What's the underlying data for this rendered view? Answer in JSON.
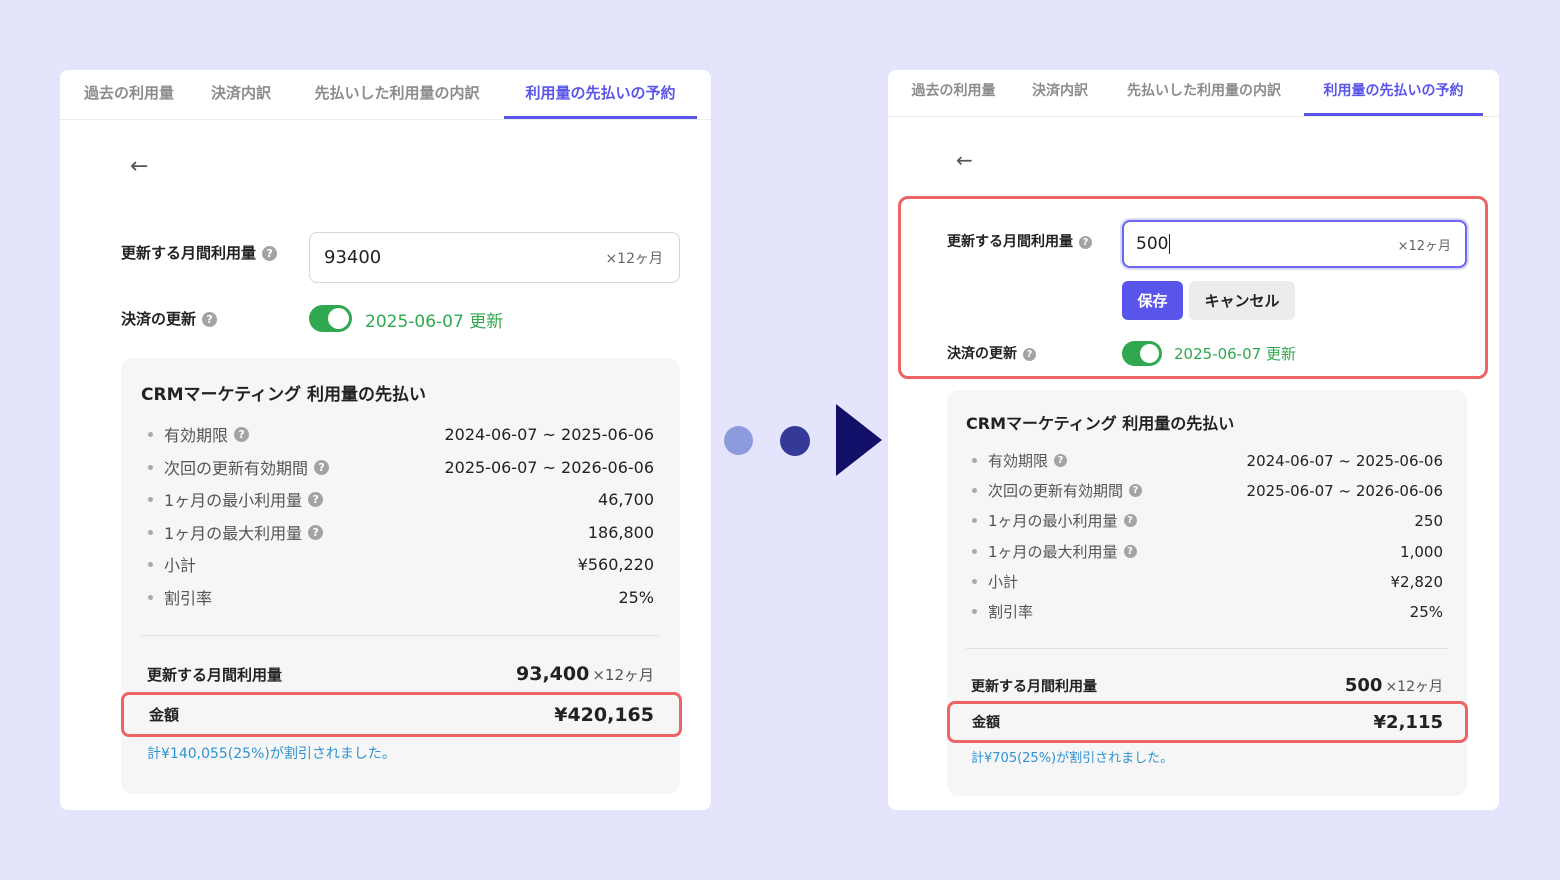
{
  "colors": {
    "background": "#e4e4fd",
    "accent": "#5a55ea",
    "toggle_on": "#2fa84f",
    "highlight": "#ee6464",
    "discount_text": "#2f93d1",
    "arrow": "#13106a"
  },
  "before": {
    "tabs": [
      {
        "label": "過去の利用量",
        "active": false
      },
      {
        "label": "決済内訳",
        "active": false
      },
      {
        "label": "先払いした利用量の内訳",
        "active": false
      },
      {
        "label": "利用量の先払いの予約",
        "active": true
      }
    ],
    "back_icon": "←",
    "form": {
      "monthly_usage_label": "更新する月間利用量",
      "monthly_usage_value": "93400",
      "monthly_usage_suffix": "×12ヶ月",
      "renewal_label": "決済の更新",
      "renewal_toggle_on": true,
      "renewal_date": "2025-06-07 更新"
    },
    "summary": {
      "title": "CRMマーケティング 利用量の先払い",
      "rows": [
        {
          "label": "有効期限",
          "help": true,
          "value": "2024-06-07 ~ 2025-06-06"
        },
        {
          "label": "次回の更新有効期間",
          "help": true,
          "value": "2025-06-07 ~ 2026-06-06"
        },
        {
          "label": "1ヶ月の最小利用量",
          "help": true,
          "value": "46,700"
        },
        {
          "label": "1ヶ月の最大利用量",
          "help": true,
          "value": "186,800"
        },
        {
          "label": "小計",
          "help": false,
          "value": "¥560,220"
        },
        {
          "label": "割引率",
          "help": false,
          "value": "25%"
        }
      ],
      "monthly_label": "更新する月間利用量",
      "monthly_value": "93,400",
      "monthly_suffix": "×12ヶ月",
      "total_label": "金額",
      "total_value": "¥420,165",
      "discount_note": "計¥140,055(25%)が割引されました。"
    }
  },
  "after": {
    "tabs": [
      {
        "label": "過去の利用量",
        "active": false
      },
      {
        "label": "決済内訳",
        "active": false
      },
      {
        "label": "先払いした利用量の内訳",
        "active": false
      },
      {
        "label": "利用量の先払いの予約",
        "active": true
      }
    ],
    "back_icon": "←",
    "form": {
      "monthly_usage_label": "更新する月間利用量",
      "monthly_usage_value": "500",
      "monthly_usage_suffix": "×12ヶ月",
      "save_label": "保存",
      "cancel_label": "キャンセル",
      "renewal_label": "決済の更新",
      "renewal_toggle_on": true,
      "renewal_date": "2025-06-07 更新"
    },
    "summary": {
      "title": "CRMマーケティング 利用量の先払い",
      "rows": [
        {
          "label": "有効期限",
          "help": true,
          "value": "2024-06-07 ~ 2025-06-06"
        },
        {
          "label": "次回の更新有効期間",
          "help": true,
          "value": "2025-06-07 ~ 2026-06-06"
        },
        {
          "label": "1ヶ月の最小利用量",
          "help": true,
          "value": "250"
        },
        {
          "label": "1ヶ月の最大利用量",
          "help": true,
          "value": "1,000"
        },
        {
          "label": "小計",
          "help": false,
          "value": "¥2,820"
        },
        {
          "label": "割引率",
          "help": false,
          "value": "25%"
        }
      ],
      "monthly_label": "更新する月間利用量",
      "monthly_value": "500",
      "monthly_suffix": "×12ヶ月",
      "total_label": "金額",
      "total_value": "¥2,115",
      "discount_note": "計¥705(25%)が割引されました。"
    }
  },
  "transition": {
    "dots": [
      "#8c9bdb",
      "#353a99"
    ],
    "arrow_icon": "play-arrow"
  }
}
